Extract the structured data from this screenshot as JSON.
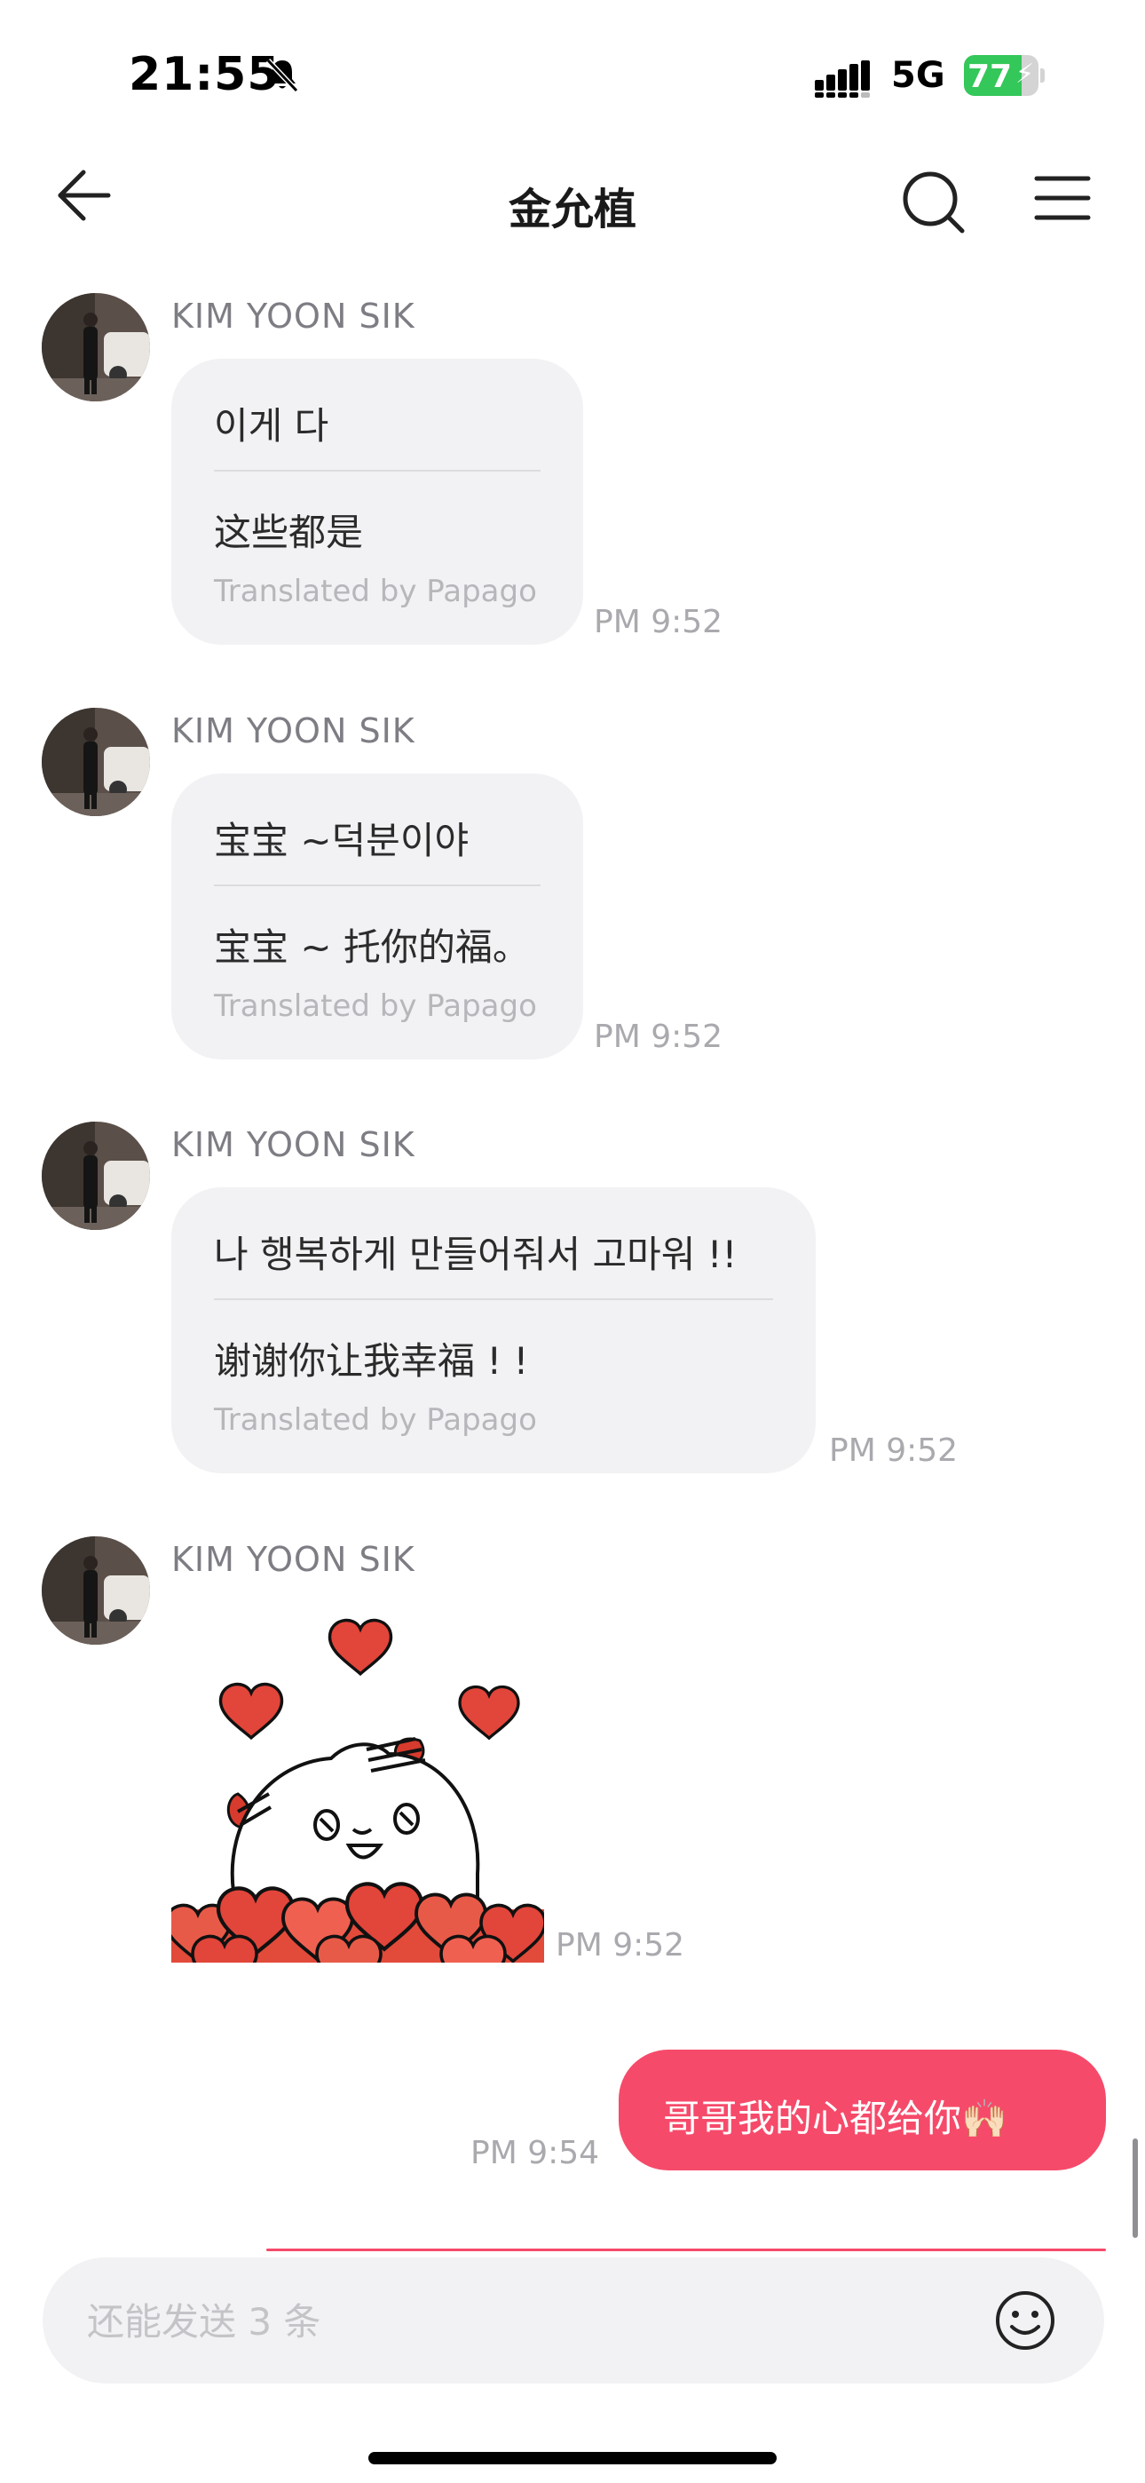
{
  "status_bar": {
    "time": "21:55",
    "network": "5G",
    "battery": 77,
    "icons": [
      "bell-muted-icon",
      "signal-icon",
      "battery-charging-icon"
    ]
  },
  "header": {
    "title": "金允植",
    "icons": [
      "back-arrow-icon",
      "search-icon",
      "menu-icon"
    ]
  },
  "messages": [
    {
      "sender": "KIM YOON SIK",
      "original": "이게 다",
      "translated": "这些都是",
      "credit": "Translated by Papago",
      "time": "PM 9:52"
    },
    {
      "sender": "KIM YOON SIK",
      "original": "宝宝 ~덕분이야",
      "translated": "宝宝 ~ 托你的福。",
      "credit": "Translated by Papago",
      "time": "PM 9:52"
    },
    {
      "sender": "KIM YOON SIK",
      "original": "나 행복하게 만들어줘서 고마워 !!",
      "translated": "谢谢你让我幸福 ! !",
      "credit": "Translated by Papago",
      "time": "PM 9:52"
    },
    {
      "sender": "KIM YOON SIK",
      "sticker": "sticker-rabbit-hearts",
      "time": "PM 9:52"
    }
  ],
  "my_message": {
    "text": "哥哥我的心都给你",
    "emoji": "🙌🏻",
    "time": "PM 9:54"
  },
  "input": {
    "placeholder": "还能发送 3 条",
    "icon": "smiley-icon"
  },
  "colors": {
    "accent": "#f64a6a",
    "bubble_bg": "#f2f2f4",
    "battery": "#34c759",
    "timestamp": "#a9a9ae"
  }
}
